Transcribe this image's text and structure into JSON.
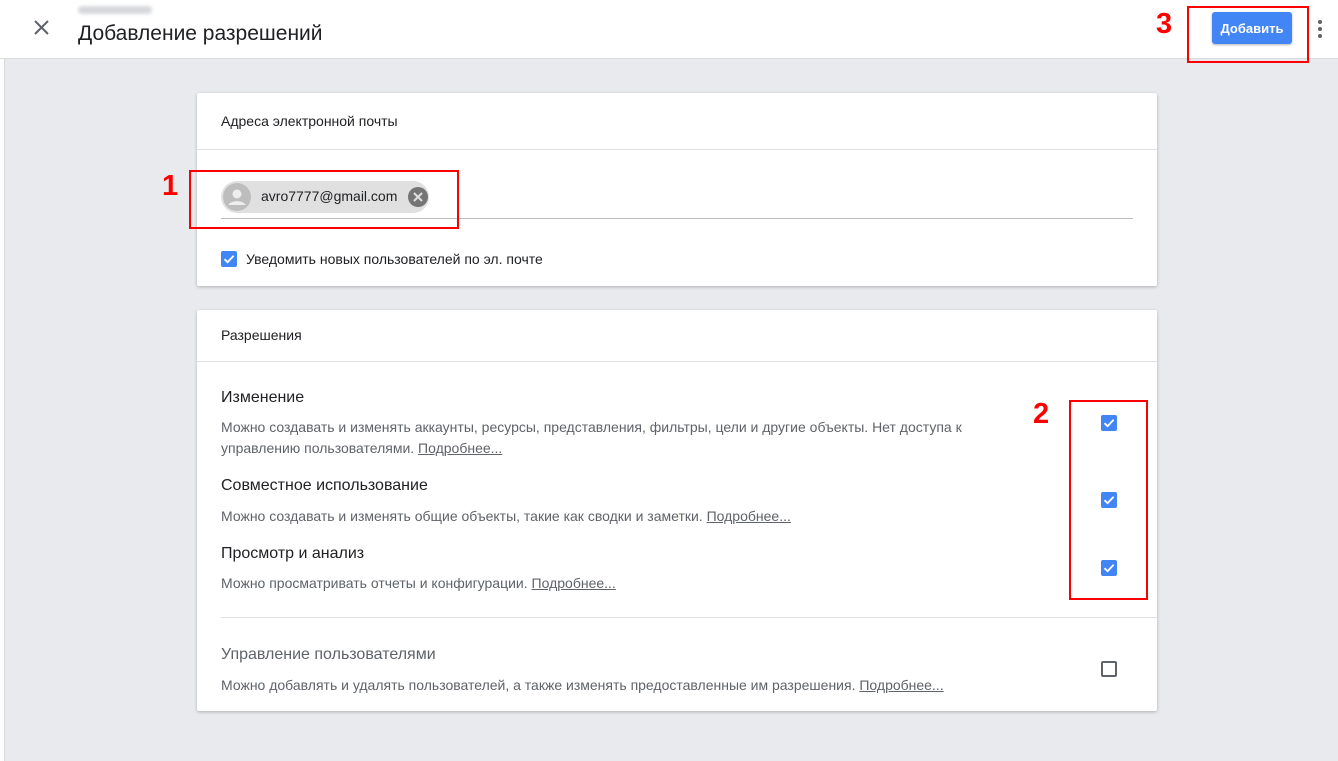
{
  "header": {
    "title": "Добавление разрешений",
    "add_label": "Добавить"
  },
  "emails_card": {
    "title": "Адреса электронной почты",
    "chip_email": "avro7777@gmail.com",
    "notify_label": "Уведомить новых пользователей по эл. почте",
    "notify_checked": true
  },
  "permissions_card": {
    "title": "Разрешения",
    "items": [
      {
        "title": "Изменение",
        "desc": "Можно создавать и изменять аккаунты, ресурсы, представления, фильтры, цели и другие объекты. Нет доступа к управлению пользователями.",
        "more": "Подробнее...",
        "checked": true
      },
      {
        "title": "Совместное использование",
        "desc": "Можно создавать и изменять общие объекты, такие как сводки и заметки.",
        "more": "Подробнее...",
        "checked": true
      },
      {
        "title": "Просмотр и анализ",
        "desc": "Можно просматривать отчеты и конфигурации.",
        "more": "Подробнее...",
        "checked": true
      },
      {
        "title": "Управление пользователями",
        "desc": "Можно добавлять и удалять пользователей, а также изменять предоставленные им разрешения.",
        "more": "Подробнее...",
        "checked": false
      }
    ]
  },
  "annotations": {
    "label_1": "1",
    "label_2": "2",
    "label_3": "3"
  },
  "colors": {
    "accent": "#4285f4",
    "annotation": "#ff0000"
  },
  "icons": {
    "close": "close-icon",
    "more": "more-vert-icon",
    "avatar": "person-icon",
    "chip_remove": "cancel-icon",
    "check": "check-icon"
  }
}
